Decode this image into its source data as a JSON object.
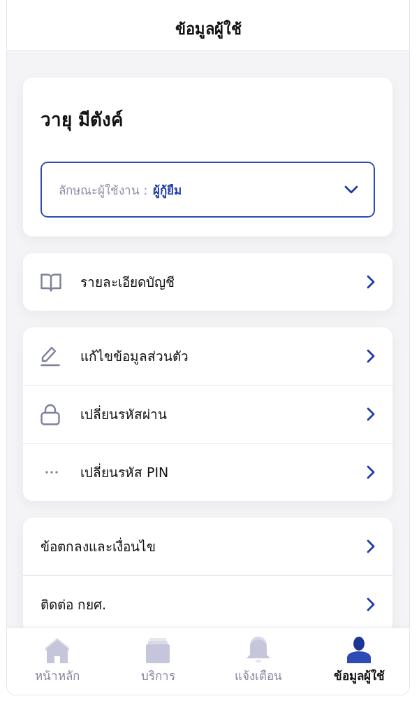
{
  "header": {
    "title": "ข้อมูลผู้ใช้"
  },
  "profile": {
    "name": "วายุ มีตังค์",
    "user_type": {
      "label": "ลักษณะผู้ใช้งาน :",
      "value": "ผู้กู้ยืม"
    }
  },
  "menu_groups": [
    {
      "items": [
        {
          "kind": "book",
          "label": "รายละเอียดบัญชี"
        }
      ]
    },
    {
      "items": [
        {
          "kind": "pencil",
          "label": "แก้ไขข้อมูลส่วนตัว"
        },
        {
          "kind": "lock",
          "label": "เปลี่ยนรหัสผ่าน"
        },
        {
          "kind": "dots",
          "label": "เปลี่ยนรหัส PIN"
        }
      ]
    },
    {
      "items": [
        {
          "kind": "text",
          "label": "ข้อตกลงและเงื่อนไข"
        },
        {
          "kind": "text",
          "label": "ติดต่อ กยศ."
        }
      ]
    }
  ],
  "tab_bar": {
    "tabs": [
      {
        "kind": "home",
        "label": "หน้าหลัก",
        "selected": false
      },
      {
        "kind": "services",
        "label": "บริการ",
        "selected": false
      },
      {
        "kind": "bell",
        "label": "แจ้งเตือน",
        "selected": false
      },
      {
        "kind": "user",
        "label": "ข้อมูลผู้ใช้",
        "selected": true
      }
    ]
  }
}
